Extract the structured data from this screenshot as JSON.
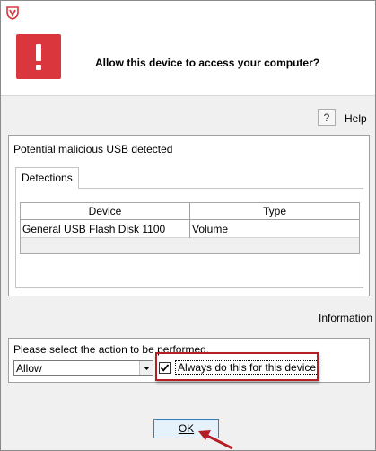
{
  "dialog": {
    "title": "Allow this device to access your computer?",
    "alert_color": "#d9363e",
    "accent_color": "#b51e24"
  },
  "help": {
    "icon_text": "?",
    "label": "Help"
  },
  "detection_panel": {
    "title": "Potential malicious USB detected",
    "tab_label": "Detections",
    "columns": [
      "Device",
      "Type"
    ],
    "rows": [
      {
        "device": "General USB Flash Disk 1100",
        "type": "Volume"
      }
    ]
  },
  "information_link": "Information",
  "action_panel": {
    "prompt": "Please select the action to be performed.",
    "selected_action": "Allow",
    "checkbox_label": "Always do this for this device",
    "checkbox_checked": true
  },
  "ok_label": "OK"
}
